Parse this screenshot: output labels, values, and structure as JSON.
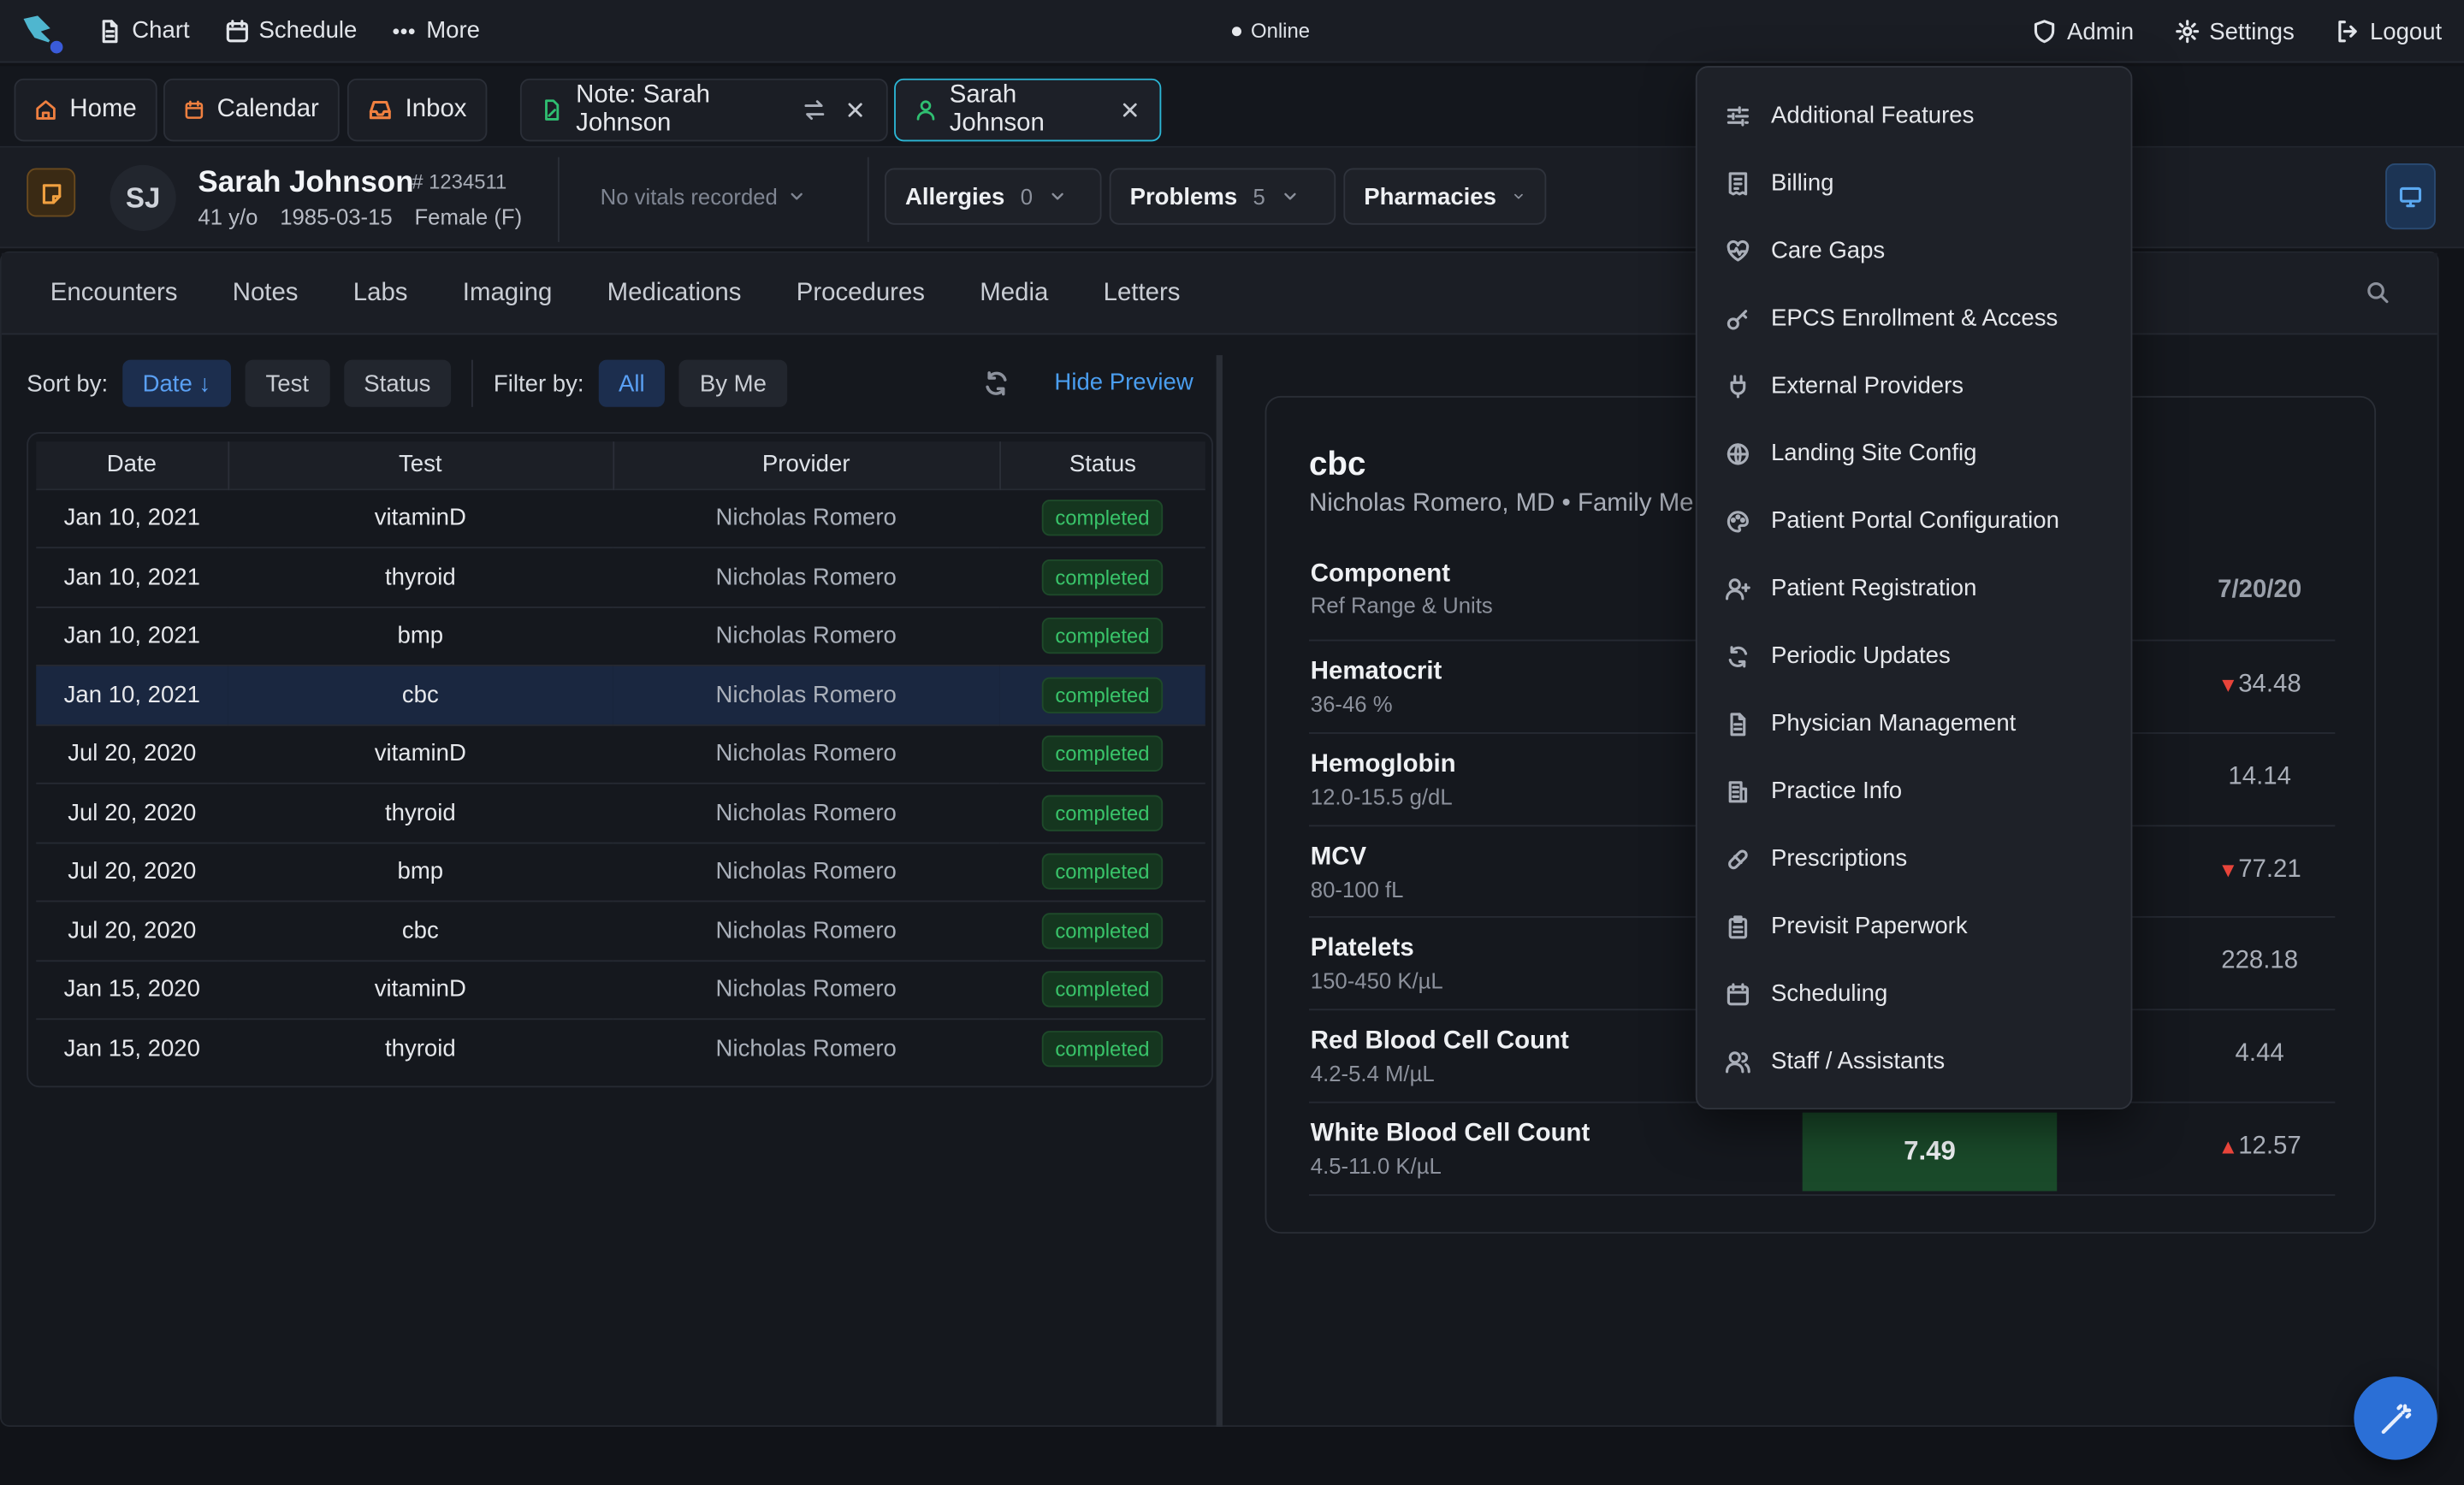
{
  "topbar": {
    "nav": [
      {
        "label": "Chart",
        "icon": "document-icon"
      },
      {
        "label": "Schedule",
        "icon": "calendar-icon"
      },
      {
        "label": "More",
        "icon": "dots-icon"
      }
    ],
    "status": "Online",
    "right": [
      {
        "label": "Admin",
        "icon": "shield-icon"
      },
      {
        "label": "Settings",
        "icon": "gear-icon"
      },
      {
        "label": "Logout",
        "icon": "logout-icon"
      }
    ]
  },
  "tabs": [
    {
      "label": "Home",
      "icon": "home-icon"
    },
    {
      "label": "Calendar",
      "icon": "calendar-icon"
    },
    {
      "label": "Inbox",
      "icon": "inbox-icon"
    },
    {
      "label": "Note: Sarah Johnson",
      "icon": "note-icon"
    },
    {
      "label": "Sarah Johnson",
      "icon": "user-icon",
      "active": true
    }
  ],
  "patient": {
    "initials": "SJ",
    "name": "Sarah Johnson",
    "id": "# 1234511",
    "age": "41 y/o",
    "dob": "1985-03-15",
    "sex": "Female (F)",
    "vitals": "No vitals recorded",
    "chips": [
      {
        "label": "Allergies",
        "count": "0"
      },
      {
        "label": "Problems",
        "count": "5"
      },
      {
        "label": "Pharmacies",
        "count": ""
      }
    ]
  },
  "subtabs": [
    "Encounters",
    "Notes",
    "Labs",
    "Imaging",
    "Medications",
    "Procedures",
    "Media",
    "Letters"
  ],
  "sortbar": {
    "sort_label": "Sort by:",
    "sort_options": [
      "Date ↓",
      "Test",
      "Status"
    ],
    "filter_label": "Filter by:",
    "filter_options": [
      "All",
      "By Me"
    ],
    "hide_preview": "Hide Preview"
  },
  "table": {
    "columns": [
      "Date",
      "Test",
      "Provider",
      "Status"
    ],
    "rows": [
      {
        "date": "Jan 10, 2021",
        "test": "vitaminD",
        "provider": "Nicholas Romero",
        "status": "completed"
      },
      {
        "date": "Jan 10, 2021",
        "test": "thyroid",
        "provider": "Nicholas Romero",
        "status": "completed"
      },
      {
        "date": "Jan 10, 2021",
        "test": "bmp",
        "provider": "Nicholas Romero",
        "status": "completed"
      },
      {
        "date": "Jan 10, 2021",
        "test": "cbc",
        "provider": "Nicholas Romero",
        "status": "completed",
        "selected": true
      },
      {
        "date": "Jul 20, 2020",
        "test": "vitaminD",
        "provider": "Nicholas Romero",
        "status": "completed"
      },
      {
        "date": "Jul 20, 2020",
        "test": "thyroid",
        "provider": "Nicholas Romero",
        "status": "completed"
      },
      {
        "date": "Jul 20, 2020",
        "test": "bmp",
        "provider": "Nicholas Romero",
        "status": "completed"
      },
      {
        "date": "Jul 20, 2020",
        "test": "cbc",
        "provider": "Nicholas Romero",
        "status": "completed"
      },
      {
        "date": "Jan 15, 2020",
        "test": "vitaminD",
        "provider": "Nicholas Romero",
        "status": "completed"
      },
      {
        "date": "Jan 15, 2020",
        "test": "thyroid",
        "provider": "Nicholas Romero",
        "status": "completed"
      }
    ]
  },
  "preview": {
    "title": "cbc",
    "subtitle": "Nicholas Romero, MD • Family Me",
    "header": {
      "name": "Component",
      "range": "Ref Range & Units",
      "col": "7/20/20"
    },
    "rows": [
      {
        "name": "Hematocrit",
        "range": "36-46 %",
        "flag": "▼",
        "value": "34.48"
      },
      {
        "name": "Hemoglobin",
        "range": "12.0-15.5 g/dL",
        "flag": "",
        "value": "14.14"
      },
      {
        "name": "MCV",
        "range": "80-100 fL",
        "flag": "▼",
        "value": "77.21"
      },
      {
        "name": "Platelets",
        "range": "150-450 K/µL",
        "flag": "",
        "value": "228.18"
      },
      {
        "name": "Red Blood Cell Count",
        "range": "4.2-5.4 M/µL",
        "flag": "",
        "value": "4.44"
      },
      {
        "name": "White Blood Cell Count",
        "range": "4.5-11.0 K/µL",
        "flag": "▲",
        "value": "12.57"
      }
    ],
    "current_value": "7.49"
  },
  "admin_menu": [
    {
      "label": "Additional Features",
      "icon": "sliders-icon"
    },
    {
      "label": "Billing",
      "icon": "receipt-icon"
    },
    {
      "label": "Care Gaps",
      "icon": "heart-pulse-icon"
    },
    {
      "label": "EPCS Enrollment & Access",
      "icon": "key-icon"
    },
    {
      "label": "External Providers",
      "icon": "plug-icon"
    },
    {
      "label": "Landing Site Config",
      "icon": "globe-icon"
    },
    {
      "label": "Patient Portal Configuration",
      "icon": "palette-icon"
    },
    {
      "label": "Patient Registration",
      "icon": "user-add-icon"
    },
    {
      "label": "Periodic Updates",
      "icon": "refresh-icon"
    },
    {
      "label": "Physician Management",
      "icon": "file-icon"
    },
    {
      "label": "Practice Info",
      "icon": "building-icon"
    },
    {
      "label": "Prescriptions",
      "icon": "pill-icon"
    },
    {
      "label": "Previsit Paperwork",
      "icon": "clipboard-icon"
    },
    {
      "label": "Scheduling",
      "icon": "calendar-icon"
    },
    {
      "label": "Staff / Assistants",
      "icon": "users-icon"
    }
  ]
}
